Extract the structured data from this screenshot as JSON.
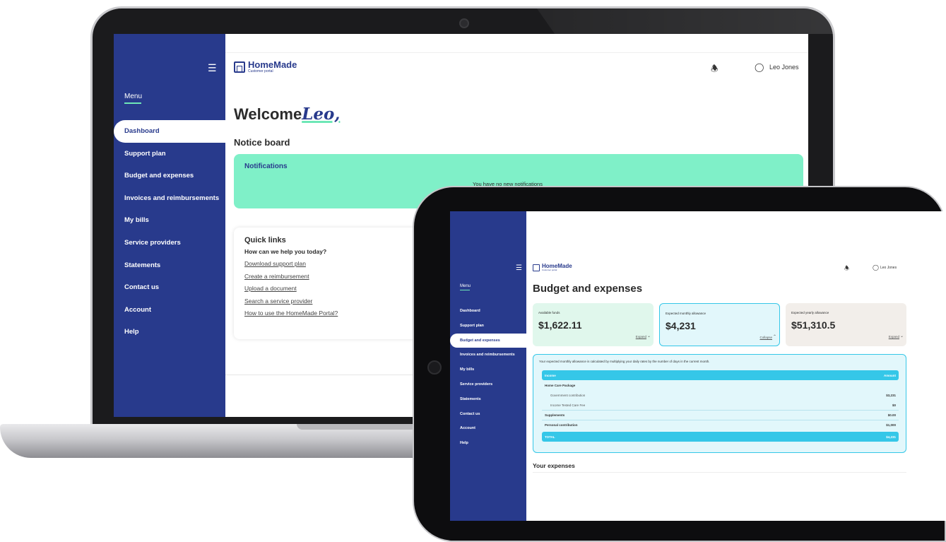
{
  "laptop": {
    "sidebar": {
      "menu_icon": "hamburger-icon",
      "menu_title": "Menu",
      "items": [
        {
          "label": "Dashboard",
          "active": true
        },
        {
          "label": "Support plan"
        },
        {
          "label": "Budget and expenses"
        },
        {
          "label": "Invoices and reimbursements"
        },
        {
          "label": "My bills"
        },
        {
          "label": "Service providers"
        },
        {
          "label": "Statements"
        },
        {
          "label": "Contact us"
        },
        {
          "label": "Account"
        },
        {
          "label": "Help"
        }
      ]
    },
    "header": {
      "logo_name": "HomeMade",
      "logo_sub": "Customer portal",
      "user_name": "Leo Jones"
    },
    "welcome": {
      "prefix": "Welcome",
      "name": "Leo,"
    },
    "notice_board": {
      "title": "Notice board",
      "notifications_title": "Notifications",
      "empty_text": "You have no new notifications"
    },
    "quick_links": {
      "title": "Quick links",
      "subtitle": "How can we help you today?",
      "links": [
        "Download support plan",
        "Create a reimbursement",
        "Upload a document",
        "Search a service provider",
        "How to use the HomeMade Portal?"
      ]
    }
  },
  "tablet": {
    "sidebar": {
      "menu_title": "Menu",
      "items": [
        {
          "label": "Dashboard"
        },
        {
          "label": "Support plan"
        },
        {
          "label": "Budget and expenses",
          "active": true
        },
        {
          "label": "Invoices and reimbursements"
        },
        {
          "label": "My bills"
        },
        {
          "label": "Service providers"
        },
        {
          "label": "Statements"
        },
        {
          "label": "Contact us"
        },
        {
          "label": "Account"
        },
        {
          "label": "Help"
        }
      ]
    },
    "header": {
      "logo_name": "HomeMade",
      "logo_sub": "Customer portal",
      "user_name": "Leo Jones"
    },
    "page_title": "Budget and expenses",
    "cards": [
      {
        "label": "Available funds",
        "value": "$1,622.11",
        "action": "Expand"
      },
      {
        "label": "Expected monthly allowance",
        "value": "$4,231",
        "action": "Collapse"
      },
      {
        "label": "Expected yearly allowance",
        "value": "$51,310.5",
        "action": "Expand"
      }
    ],
    "allowance": {
      "note": "Your expected monthly allowance is calculated by multiplying your daily rates by the number of days in the current month.",
      "header_income": "Income",
      "header_amount": "Amount",
      "rows": [
        {
          "label": "Home Care Package",
          "amount": ""
        },
        {
          "label": "Government contribution",
          "amount": "$3,231"
        },
        {
          "label": "Income Tested Care Fee",
          "amount": "$0"
        },
        {
          "label": "Supplements",
          "amount": "$0.00"
        },
        {
          "label": "Personal contribution",
          "amount": "$1,000"
        }
      ],
      "total_label": "TOTAL",
      "total_amount": "$4,231"
    },
    "expenses_title": "Your expenses"
  },
  "colors": {
    "sidebar": "#283a8c",
    "accent_green": "#7ff0c8",
    "accent_cyan": "#35c7e8"
  }
}
